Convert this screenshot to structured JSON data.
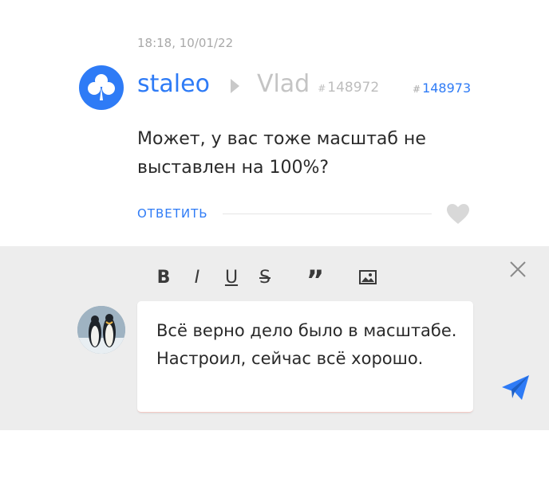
{
  "comment": {
    "timestamp": "18:18, 10/01/22",
    "author": "staleo",
    "reply_to_name": "Vlad",
    "reply_to_hash": "#",
    "reply_to_id": "148972",
    "self_hash": "#",
    "self_id": "148973",
    "text": "Может, у вас тоже масштаб не выставлен на 100%?",
    "reply_label": "ОТВЕТИТЬ",
    "avatar_icon": "clover-icon",
    "like_icon": "heart-icon"
  },
  "editor": {
    "toolbar": {
      "bold": "B",
      "italic": "I",
      "underline": "U",
      "strike": "S",
      "quote": "”"
    },
    "draft_text": "Всё верно дело было в масштабе. Настроил, сейчас всё хорошо.",
    "send_icon": "paper-plane-icon",
    "close_icon": "close-icon"
  },
  "colors": {
    "accent": "#2e7bf6",
    "editor_bg": "#ededed",
    "muted": "#a9a9a9"
  }
}
